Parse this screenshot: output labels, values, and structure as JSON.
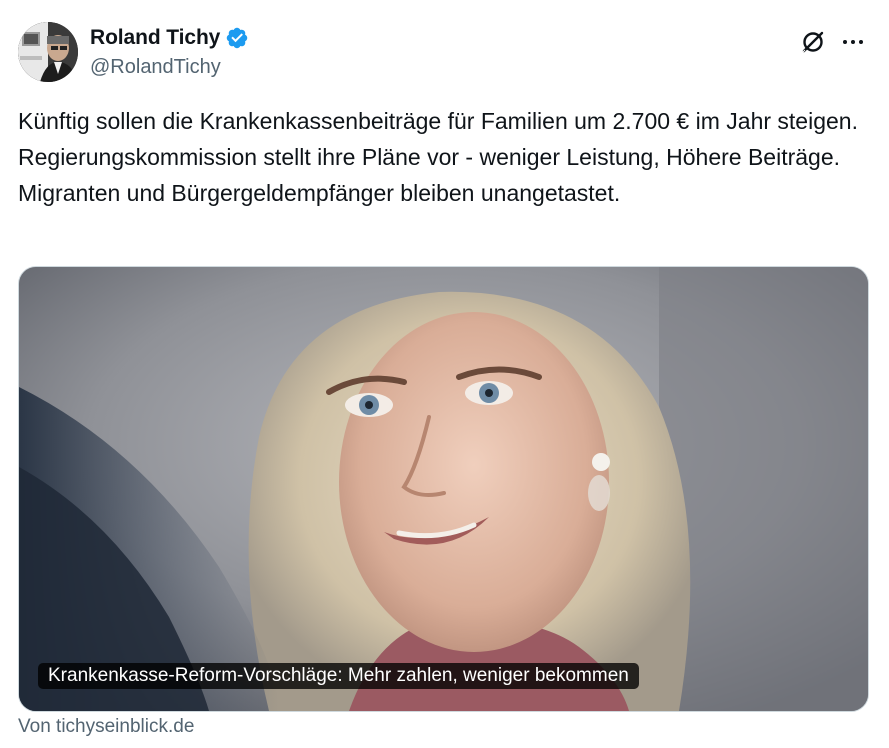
{
  "author": {
    "display_name": "Roland Tichy",
    "handle": "@RolandTichy",
    "verified": true,
    "verified_color": "#1d9bf0"
  },
  "header_actions": {
    "grok_icon": "grok-icon",
    "more_icon": "more-icon"
  },
  "tweet": {
    "text": "Künftig sollen die Krankenkassenbeiträge für Familien um 2.700 € im Jahr steigen. Regierungskommission stellt ihre Pläne vor - weniger Leistung, Höhere Beiträge. Migranten und Bürgergeldempfänger bleiben unangetastet."
  },
  "card": {
    "title": "Krankenkasse-Reform-Vorschläge: Mehr zahlen, weniger bekommen",
    "source": "Von tichyseinblick.de"
  },
  "colors": {
    "text_primary": "#0f1419",
    "text_secondary": "#536471",
    "border": "#cfd9de"
  }
}
